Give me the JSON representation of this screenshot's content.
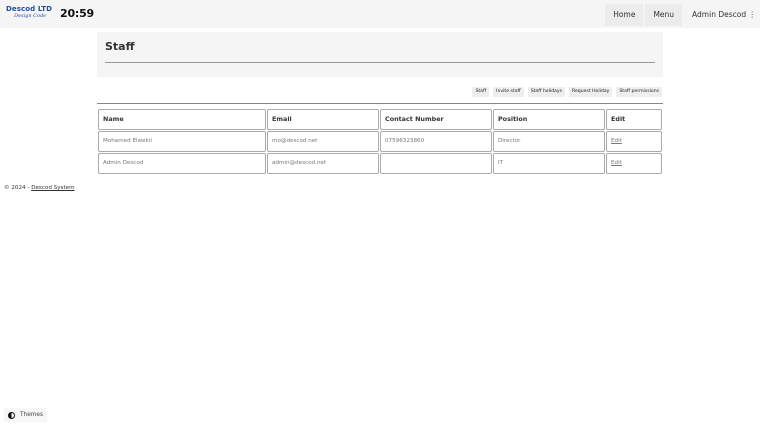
{
  "brand": {
    "logo_text": "Descod LTD",
    "logo_tagline": "Design Code"
  },
  "clock": "20:59",
  "nav": {
    "home": "Home",
    "menu": "Menu",
    "user": "Admin Descod",
    "user_caret": "⋮"
  },
  "page": {
    "title": "Staff"
  },
  "subnav": [
    "Staff",
    "Invite staff",
    "Staff holidays",
    "Request Holiday",
    "Staff permissions"
  ],
  "table": {
    "headers": [
      "Name",
      "Email",
      "Contact Number",
      "Position",
      "Edit"
    ],
    "rows": [
      [
        "Mohamed Elwekil",
        "mo@descod.net",
        "07596323860",
        "Director",
        "Edit"
      ],
      [
        "Admin Descod",
        "admin@descod.net",
        "",
        "IT",
        "Edit"
      ]
    ]
  },
  "footer": {
    "prefix": "© 2024 -",
    "link": "Descod System"
  },
  "themes": {
    "label": "Themes",
    "icon": "half-circle-icon"
  },
  "colors": {
    "brand_blue": "#1d4fa3",
    "bar_bg": "#f5f5f5"
  }
}
